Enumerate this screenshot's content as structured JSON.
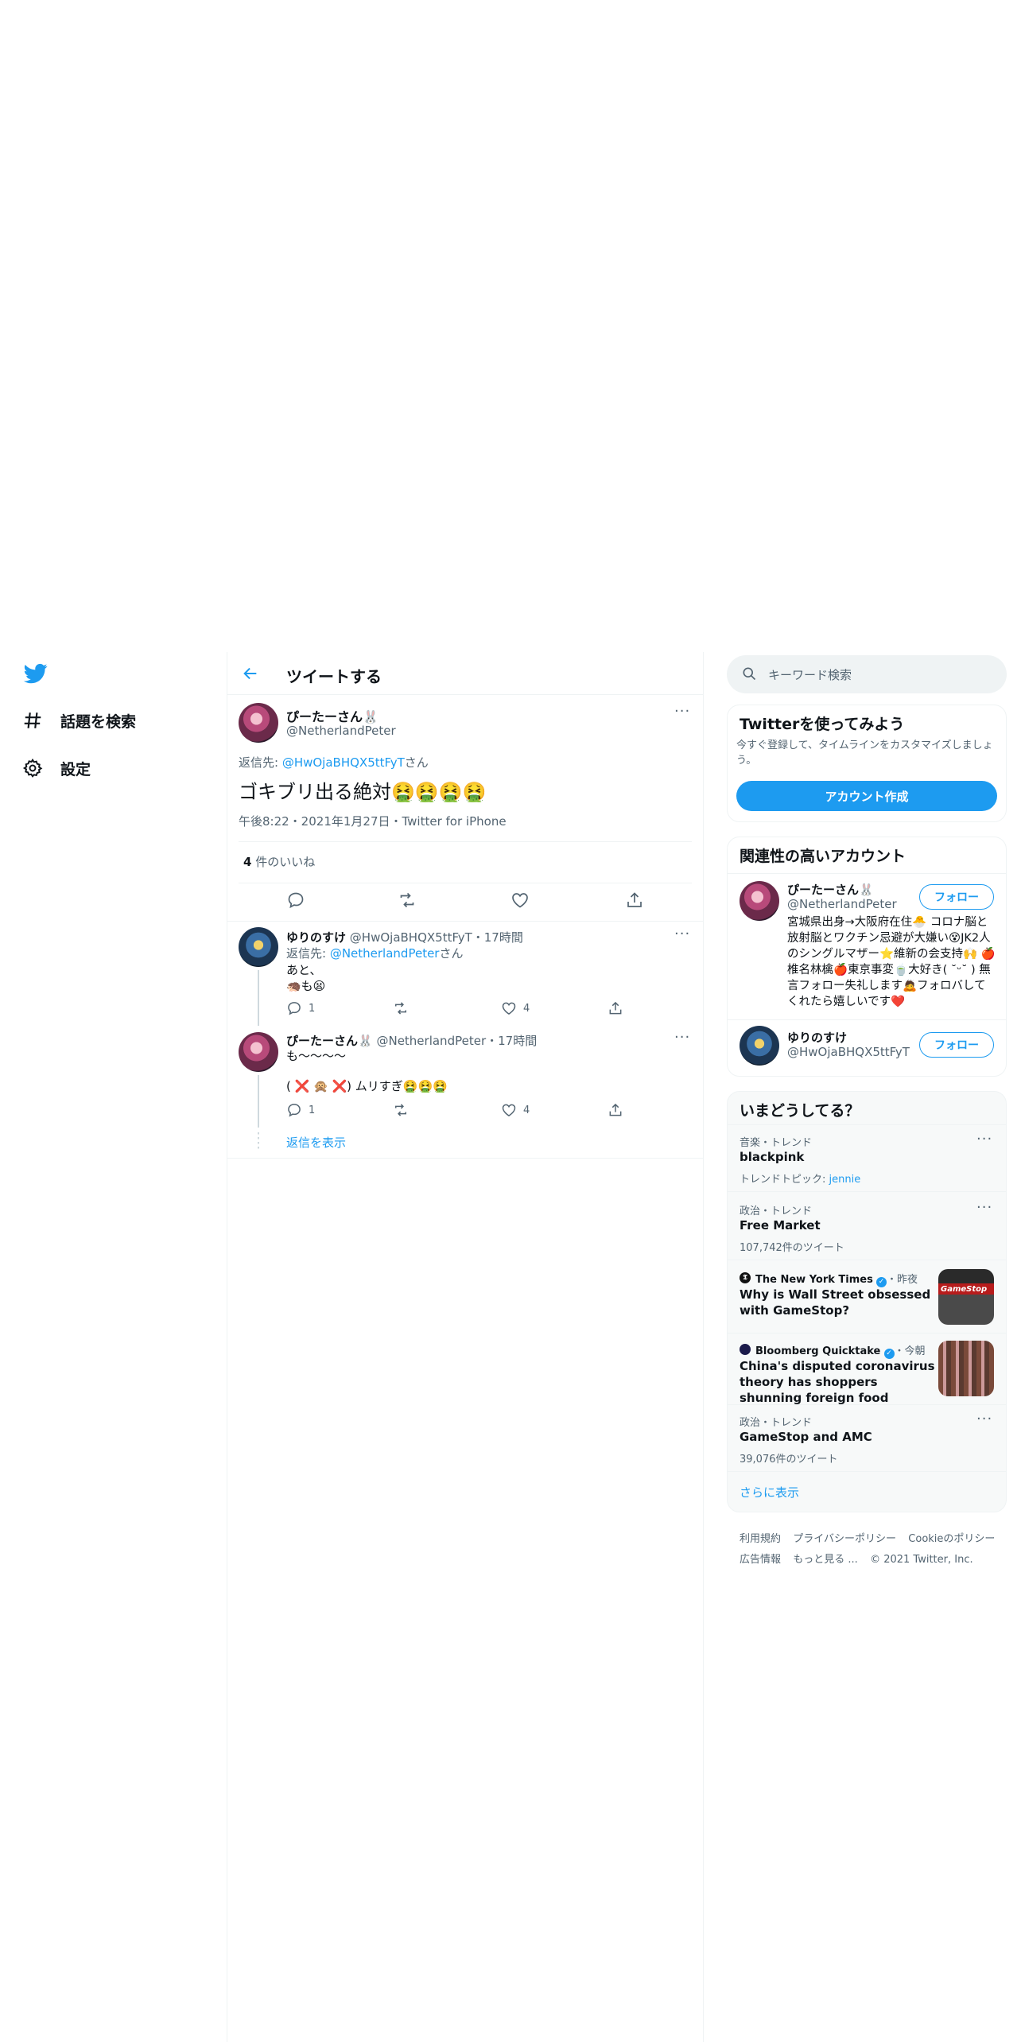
{
  "nav": {
    "logo_icon": "twitter-bird-icon",
    "items": [
      {
        "label": "話題を検索",
        "icon": "hashtag-icon"
      },
      {
        "label": "設定",
        "icon": "gear-icon"
      }
    ]
  },
  "header": {
    "title": "ツイートする",
    "back_icon": "back-arrow-icon"
  },
  "main_tweet": {
    "display_name": "ぴーたーさん🐰",
    "handle": "@NetherlandPeter",
    "reply_prefix": "返信先: ",
    "reply_to": "@HwOjaBHQX5ttFyT",
    "reply_suffix": "さん",
    "text": "ゴキブリ出る絶対🤮🤮🤮🤮",
    "meta": "午後8:22・2021年1月27日・Twitter for iPhone",
    "likes_count": "4",
    "likes_label": " 件のいいね"
  },
  "replies": [
    {
      "display_name": "ゆりのすけ",
      "handle": "@HwOjaBHQX5ttFyT",
      "time": "・17時間",
      "reply_prefix": "返信先: ",
      "reply_to": "@NetherlandPeter",
      "reply_suffix": "さん",
      "line1": "あと、",
      "line2": "🦔も😫",
      "reply_count": "1",
      "like_count": "4"
    },
    {
      "display_name": "ぴーたーさん🐰",
      "handle": "@NetherlandPeter",
      "time": "・17時間",
      "line1": "も〜〜〜〜",
      "line2": "( ❌ 🙊 ❌) ムリすぎ🤮🤮🤮",
      "reply_count": "1",
      "like_count": "4"
    }
  ],
  "show_replies": "返信を表示",
  "search": {
    "placeholder": "キーワード検索"
  },
  "signup": {
    "title": "Twitterを使ってみよう",
    "desc": "今すぐ登録して、タイムラインをカスタマイズしましょう。",
    "button": "アカウント作成"
  },
  "related": {
    "title": "関連性の高いアカウント",
    "follow_label": "フォロー",
    "accounts": [
      {
        "display_name": "ぴーたーさん🐰",
        "handle": "@NetherlandPeter",
        "bio": "宮城県出身→大阪府在住🐣 コロナ脳と放射脳とワクチン忌避が大嫌い😵JK2人のシングルマザー⭐維新の会支持🙌 🍎椎名林檎🍎東京事変🍵大好き( ˘ᵕ˘ ) 無言フォロー失礼します🙇フォロバしてくれたら嬉しいです❤️"
      },
      {
        "display_name": "ゆりのすけ",
        "handle": "@HwOjaBHQX5ttFyT"
      }
    ]
  },
  "trends": {
    "title": "いまどうしてる？",
    "items": [
      {
        "meta": "音楽・トレンド",
        "name": "blackpink",
        "sub_prefix": "トレンドトピック: ",
        "sub_link": "jennie"
      },
      {
        "meta": "政治・トレンド",
        "name": "Free Market",
        "sub": "107,742件のツイート"
      },
      {
        "source": "The New York Times",
        "time": "・昨夜",
        "headline": "Why is Wall Street obsessed with GameStop?",
        "thumb_text": "GameStop"
      },
      {
        "source": "Bloomberg Quicktake",
        "time": "・今朝",
        "headline": "China's disputed coronavirus theory has shoppers shunning foreign food"
      },
      {
        "meta": "政治・トレンド",
        "name": "GameStop and AMC",
        "sub": "39,076件のツイート"
      }
    ],
    "more": "さらに表示"
  },
  "footer": {
    "links": [
      "利用規約",
      "プライバシーポリシー",
      "Cookieのポリシー",
      "広告情報",
      "もっと見る ..."
    ],
    "copyright": "© 2021 Twitter, Inc."
  },
  "colors": {
    "accent": "#1d9bf0",
    "text": "#0f1419",
    "muted": "#536471",
    "border": "#eff3f4"
  }
}
